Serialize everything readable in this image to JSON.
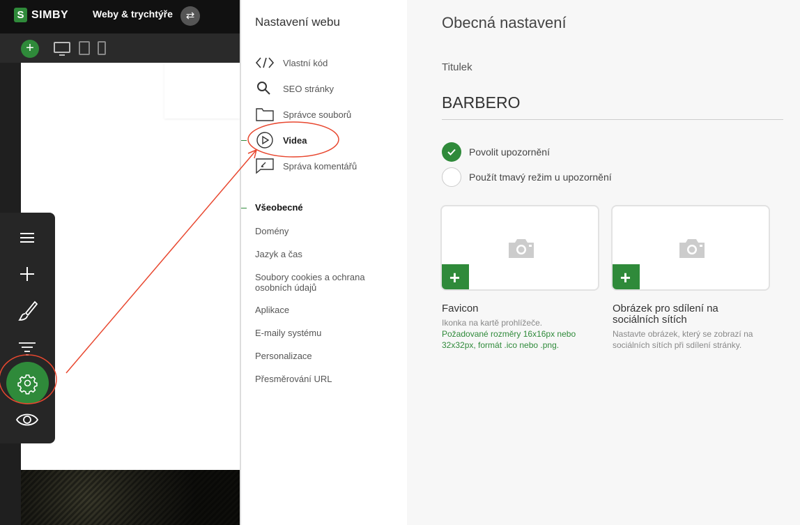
{
  "topbar": {
    "logo_text": "SIMBY",
    "logo_mark": "S",
    "site_name": "Weby & trychtýře",
    "swap_icon": "⇄"
  },
  "devicebar": {
    "add_label": "+"
  },
  "settings_nav": {
    "title": "Nastavení webu",
    "items": [
      {
        "label": "Vlastní kód",
        "icon": "code-icon"
      },
      {
        "label": "SEO stránky",
        "icon": "search-icon"
      },
      {
        "label": "Správce souborů",
        "icon": "folder-icon"
      },
      {
        "label": "Videa",
        "icon": "play-circle-icon"
      },
      {
        "label": "Správa komentářů",
        "icon": "comment-icon"
      }
    ],
    "section_title": "Všeobecné",
    "section_items": [
      "Domény",
      "Jazyk a čas",
      "Soubory cookies a ochrana osobních údajů",
      "Aplikace",
      "E-maily systému",
      "Personalizace",
      "Přesměrování URL"
    ]
  },
  "content": {
    "title": "Obecná nastavení",
    "field_label": "Titulek",
    "title_value": "BARBERO",
    "options": [
      {
        "label": "Povolit upozornění",
        "checked": true
      },
      {
        "label": "Použít tmavý režim u upozornění",
        "checked": false
      }
    ],
    "favicon": {
      "heading": "Favicon",
      "description": "Ikonka na kartě prohlížeče.",
      "requirements": "Požadované rozměry 16x16px nebo 32x32px, formát .ico nebo .png."
    },
    "share_image": {
      "heading": "Obrázek pro sdílení na sociálních sítích",
      "description": "Nastavte obrázek, který se zobrazí na sociálních sítích při sdílení stránky."
    },
    "plus_label": "+"
  },
  "colors": {
    "accent": "#2f8a3a",
    "annotation": "#e8472f",
    "dark_bg": "#1f1f1f"
  }
}
